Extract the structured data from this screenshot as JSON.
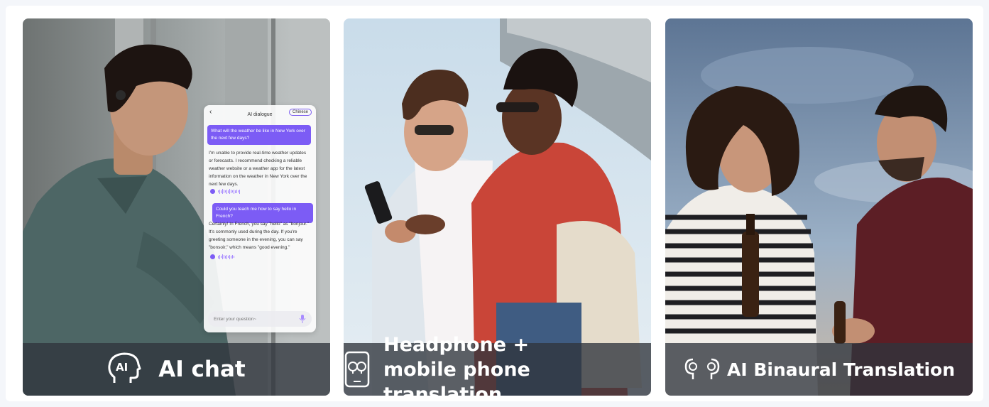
{
  "cards": [
    {
      "caption": "AI chat",
      "icon": "ai-head-icon",
      "chat": {
        "title": "AI dialogue",
        "language": "Chinese",
        "user_message_1": "What will the weather be like in New York over the next few days?",
        "bot_message_1": "I'm unable to provide real-time weather updates or forecasts. I recommend checking a reliable weather website or a weather app for the latest information on the weather in New York over the next few days.",
        "user_message_2": "Could you teach me how to say hello in French?",
        "bot_message_2": "Certainly! In French, you say \"hello\" as \"bonjour.\" It's commonly used during the day. If you're greeting someone in the evening, you can say \"bonsoir,\" which means \"good evening.\"",
        "input_placeholder": "Enter your question~"
      }
    },
    {
      "caption_line1": "Headphone +",
      "caption_line2": "mobile phone translation",
      "icon": "phone-earbuds-icon"
    },
    {
      "caption": "AI Binaural Translation",
      "icon": "binaural-earbuds-icon"
    }
  ],
  "colors": {
    "accent": "#7c5cf5",
    "caption_bg": "#30343c"
  }
}
